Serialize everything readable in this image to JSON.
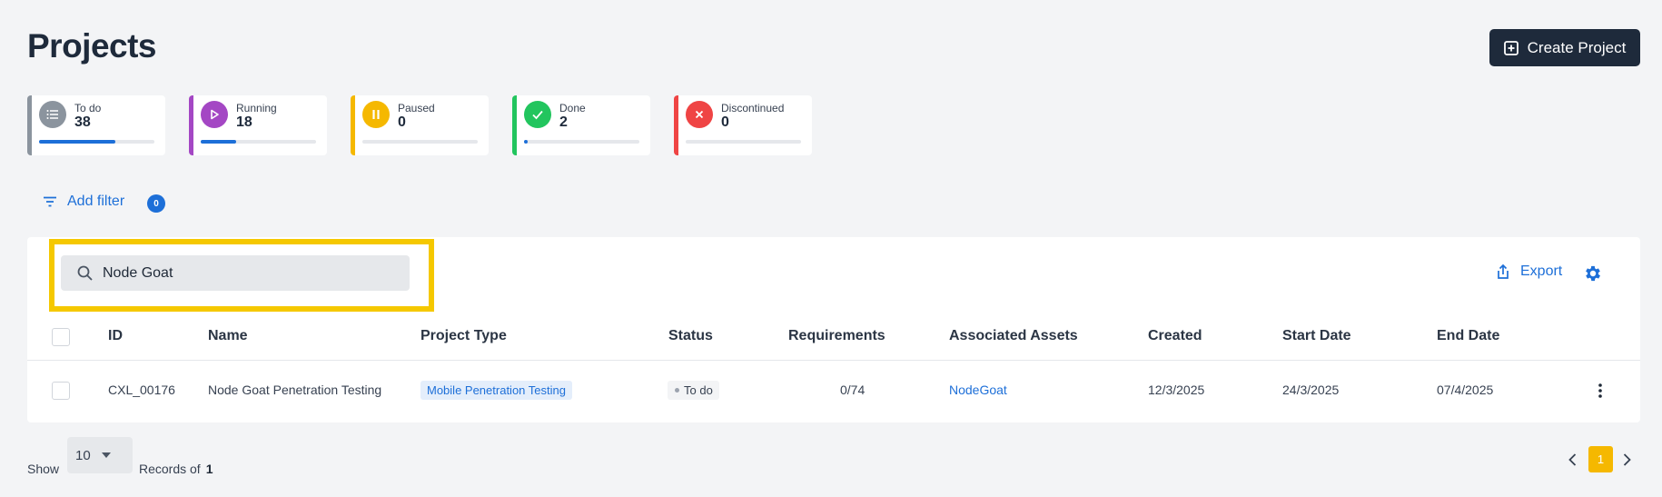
{
  "page": {
    "title": "Projects"
  },
  "toolbar": {
    "create_label": "Create Project"
  },
  "stats": [
    {
      "label": "To do",
      "count": "38",
      "color": "#8b949e",
      "icon": "list-icon",
      "progress_percent": 66
    },
    {
      "label": "Running",
      "count": "18",
      "color": "#a447c4",
      "icon": "play-icon",
      "progress_percent": 31
    },
    {
      "label": "Paused",
      "count": "0",
      "color": "#f5b800",
      "icon": "pause-icon",
      "progress_percent": 0
    },
    {
      "label": "Done",
      "count": "2",
      "color": "#22c55e",
      "icon": "check-icon",
      "progress_percent": 3
    },
    {
      "label": "Discontinued",
      "count": "0",
      "color": "#ef4444",
      "icon": "close-icon",
      "progress_percent": 0
    }
  ],
  "filter": {
    "label": "Add filter",
    "count": "0"
  },
  "search": {
    "value": "Node Goat",
    "placeholder": "Search"
  },
  "actions": {
    "export_label": "Export"
  },
  "table": {
    "columns": [
      "ID",
      "Name",
      "Project Type",
      "Status",
      "Requirements",
      "Associated Assets",
      "Created",
      "Start Date",
      "End Date"
    ],
    "rows": [
      {
        "id": "CXL_00176",
        "name": "Node Goat Penetration Testing",
        "project_type": "Mobile Penetration Testing",
        "status": "To do",
        "requirements": "0/74",
        "assets": "NodeGoat",
        "created": "12/3/2025",
        "start_date": "24/3/2025",
        "end_date": "07/4/2025"
      }
    ]
  },
  "pagination": {
    "show_label": "Show",
    "page_size": "10",
    "records_label": "Records of",
    "records_total": "1",
    "current_page": "1"
  },
  "colors": {
    "accent": "#1d6fd8",
    "dark": "#1e2a3b",
    "highlight": "#f5c800",
    "page_active": "#f5b800"
  }
}
